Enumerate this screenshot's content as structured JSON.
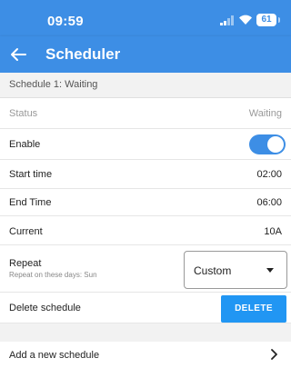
{
  "status_bar": {
    "time": "09:59",
    "battery": "61"
  },
  "app_bar": {
    "title": "Scheduler"
  },
  "section": {
    "label": "Schedule 1: Waiting"
  },
  "rows": {
    "status": {
      "label": "Status",
      "value": "Waiting"
    },
    "enable": {
      "label": "Enable",
      "toggle_on": true
    },
    "start_time": {
      "label": "Start time",
      "value": "02:00"
    },
    "end_time": {
      "label": "End Time",
      "value": "06:00"
    },
    "current": {
      "label": "Current",
      "value": "10A"
    },
    "repeat": {
      "label": "Repeat",
      "sublabel": "Repeat on these days: Sun",
      "selected": "Custom"
    },
    "delete": {
      "label": "Delete schedule",
      "button": "DELETE"
    }
  },
  "add": {
    "label": "Add a new schedule"
  },
  "colors": {
    "accent": "#3d8ee5",
    "button": "#2196f3"
  }
}
